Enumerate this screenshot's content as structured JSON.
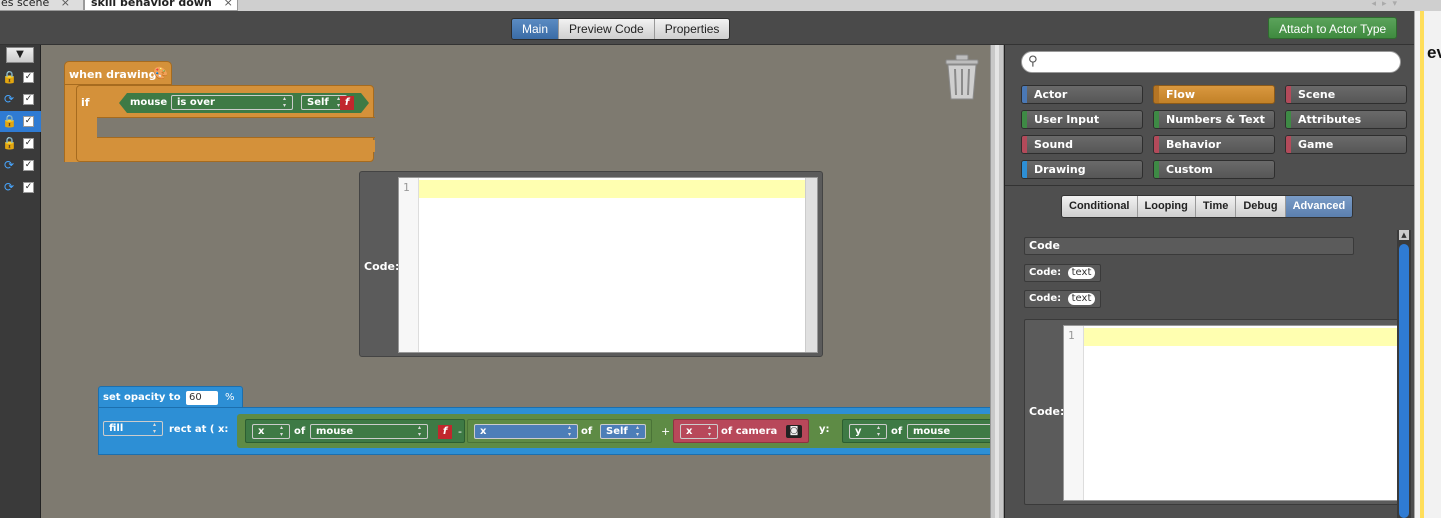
{
  "tabs": {
    "items": [
      {
        "label": "udes scene",
        "close": "×"
      },
      {
        "label": "skill behavior down",
        "close": "×"
      }
    ]
  },
  "toolbar": {
    "modes": [
      "Main",
      "Preview Code",
      "Properties"
    ],
    "active_mode": "Main",
    "attach_label": "Attach to Actor Type"
  },
  "gutter": {
    "dropdown": "▼",
    "rows": [
      {
        "icon": "lock-icon",
        "checked": true
      },
      {
        "icon": "loop-icon",
        "checked": true
      },
      {
        "icon": "lock-icon",
        "checked": true,
        "selected": true
      },
      {
        "icon": "lock-icon",
        "checked": true
      },
      {
        "icon": "loop-icon",
        "checked": true
      },
      {
        "icon": "loop-icon",
        "checked": true
      }
    ]
  },
  "canvas": {
    "event_label": "when drawing",
    "if_label": "if",
    "condition": {
      "subject": "mouse",
      "operator": "is over",
      "target": "Self"
    },
    "code_block": {
      "label": "Code:",
      "line_number": "1"
    },
    "set_opacity": {
      "label": "set opacity to",
      "value": "60",
      "unit": "%"
    },
    "rect": {
      "mode": "fill",
      "label": "rect at ( x:",
      "x_expr": {
        "left": {
          "prop": "x",
          "of": "of",
          "source": "mouse"
        },
        "minus": "-",
        "mid": {
          "prop": "x",
          "of": "of",
          "source": "Self"
        },
        "plus": "+",
        "right": {
          "prop": "x",
          "of": "of camera"
        }
      },
      "y_label": "y:",
      "y_expr": {
        "prop": "y",
        "of": "of",
        "source": "mouse"
      }
    }
  },
  "palette": {
    "search_placeholder": "",
    "categories": [
      {
        "label": "Actor",
        "color": "#4a78b5"
      },
      {
        "label": "Flow",
        "color": "#d4913a",
        "active": true
      },
      {
        "label": "Scene",
        "color": "#b34a5a"
      },
      {
        "label": "User Input",
        "color": "#3e8a45"
      },
      {
        "label": "Numbers & Text",
        "color": "#3e8a45"
      },
      {
        "label": "Attributes",
        "color": "#3e8a45"
      },
      {
        "label": "Sound",
        "color": "#b34a5a"
      },
      {
        "label": "Behavior",
        "color": "#b34a5a"
      },
      {
        "label": "Game",
        "color": "#b34a5a"
      },
      {
        "label": "Drawing",
        "color": "#2d8fd5"
      },
      {
        "label": "Custom",
        "color": "#3e8a45"
      }
    ],
    "sub_tabs": [
      "Conditional",
      "Looping",
      "Time",
      "Debug",
      "Advanced"
    ],
    "active_sub_tab": "Advanced",
    "blocks": {
      "header": "Code",
      "code_text_1": {
        "label": "Code:",
        "pill": "text"
      },
      "code_text_2": {
        "label": "Code:",
        "pill": "text"
      },
      "code_block_label": "Code:",
      "line_number": "1"
    }
  },
  "right_edge": {
    "text": "evi"
  },
  "colors": {
    "canvas_bg": "#7e7a70",
    "flow_orange": "#d4913a",
    "boolean_green": "#3e7a45",
    "drawing_blue": "#2d8fd5",
    "attach_green": "#4a9a4a"
  }
}
